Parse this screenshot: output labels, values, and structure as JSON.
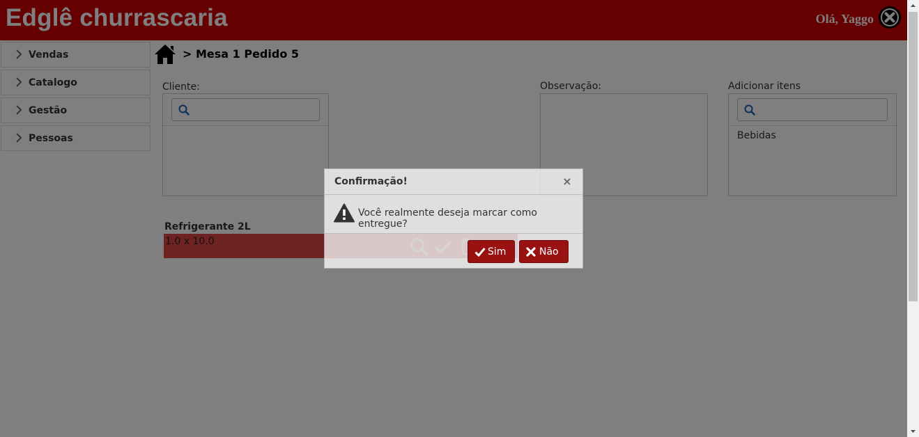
{
  "header": {
    "title": "Edglê churrascaria",
    "greeting": "Olá, Yaggo",
    "logout_icon": "close-circle-icon"
  },
  "sidebar": {
    "items": [
      {
        "label": "Vendas",
        "icon": "chevron-right-icon"
      },
      {
        "label": "Catalogo",
        "icon": "chevron-right-icon"
      },
      {
        "label": "Gestão",
        "icon": "chevron-right-icon"
      },
      {
        "label": "Pessoas",
        "icon": "chevron-right-icon"
      }
    ]
  },
  "breadcrumb": {
    "home_icon": "home-icon",
    "text": "> Mesa 1 Pedido 5"
  },
  "cliente": {
    "label": "Cliente:",
    "search_placeholder": ""
  },
  "observacao": {
    "label": "Observação:"
  },
  "adicionar": {
    "label": "Adicionar itens",
    "search_placeholder": "",
    "categories": [
      "Bebidas"
    ]
  },
  "order_items": [
    {
      "name": "Refrigerante 2L",
      "quantity_text": "1.0 x 10.0",
      "actions": [
        "search-icon",
        "check-icon",
        "trash-icon"
      ]
    }
  ],
  "dialog": {
    "title": "Confirmação!",
    "close_label": "×",
    "message": "Você realmente deseja marcar como entregue?",
    "confirm_label": "Sim",
    "cancel_label": "Não"
  },
  "colors": {
    "brand": "#cc0000",
    "button": "#991111",
    "overlay": "rgba(0,0,0,0.5)"
  }
}
